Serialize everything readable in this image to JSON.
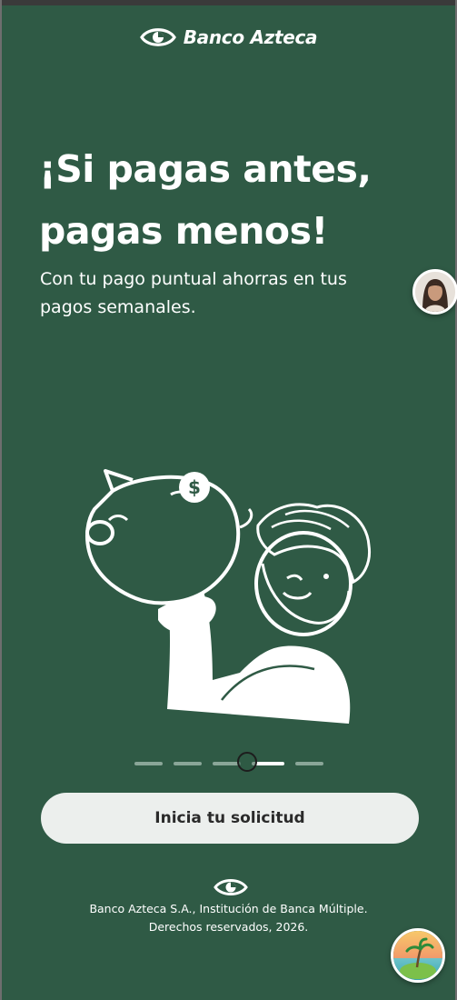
{
  "brand": {
    "name": "Banco Azteca",
    "logo_icon": "banco-azteca-eye-logo"
  },
  "hero": {
    "headline_line1": "¡Si pagas antes,",
    "headline_line2": "pagas menos!",
    "subtext_line1": "Con tu pago puntual ahorras en tus",
    "subtext_line2": "pagos semanales."
  },
  "illustration": {
    "icon": "person-holding-piggy-bank-illustration",
    "coin_symbol": "$"
  },
  "carousel": {
    "total_slides": 5,
    "active_index": 3
  },
  "cta": {
    "label": "Inicia tu solicitud"
  },
  "footer": {
    "line1": "Banco Azteca S.A., Institución de Banca Múltiple.",
    "line2": "Derechos reservados, 2026."
  },
  "floating": {
    "assistant_avatar_icon": "assistant-avatar",
    "corner_badge_icon": "beach-island-badge-icon"
  },
  "colors": {
    "background": "#2f5a45",
    "text": "#ffffff",
    "button_bg": "#ecefed",
    "button_text": "#2a2a2a",
    "inactive_dot": "#8aa698"
  }
}
